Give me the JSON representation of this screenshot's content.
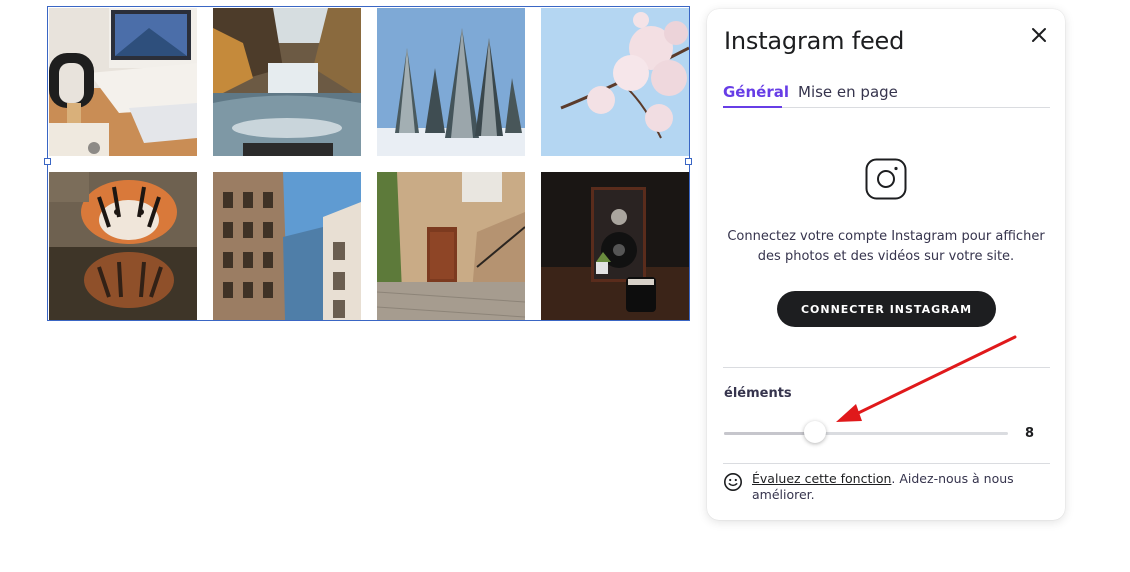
{
  "panel": {
    "title": "Instagram feed",
    "tabs": [
      {
        "label": "Général",
        "active": true
      },
      {
        "label": "Mise en page",
        "active": false
      }
    ],
    "connect_text": "Connectez votre compte Instagram pour afficher des photos et des vidéos sur votre site.",
    "connect_button": "CONNECTER INSTAGRAM",
    "elements": {
      "label": "éléments",
      "value": "8",
      "slider_fraction": 0.32
    },
    "feedback": {
      "link": "Évaluez cette fonction",
      "text": ". Aidez-nous à nous améliorer."
    }
  },
  "grid": {
    "tiles": [
      {
        "name": "photo-laptop-desk"
      },
      {
        "name": "photo-waterfall"
      },
      {
        "name": "photo-snowy-trees"
      },
      {
        "name": "photo-cherry-blossom"
      },
      {
        "name": "photo-tiger"
      },
      {
        "name": "photo-buildings"
      },
      {
        "name": "photo-stone-street"
      },
      {
        "name": "photo-speaker"
      }
    ]
  },
  "colors": {
    "accent": "#673de6",
    "selection": "#3a66c4",
    "button": "#1d1e20",
    "annotation_arrow": "#e0191b"
  }
}
